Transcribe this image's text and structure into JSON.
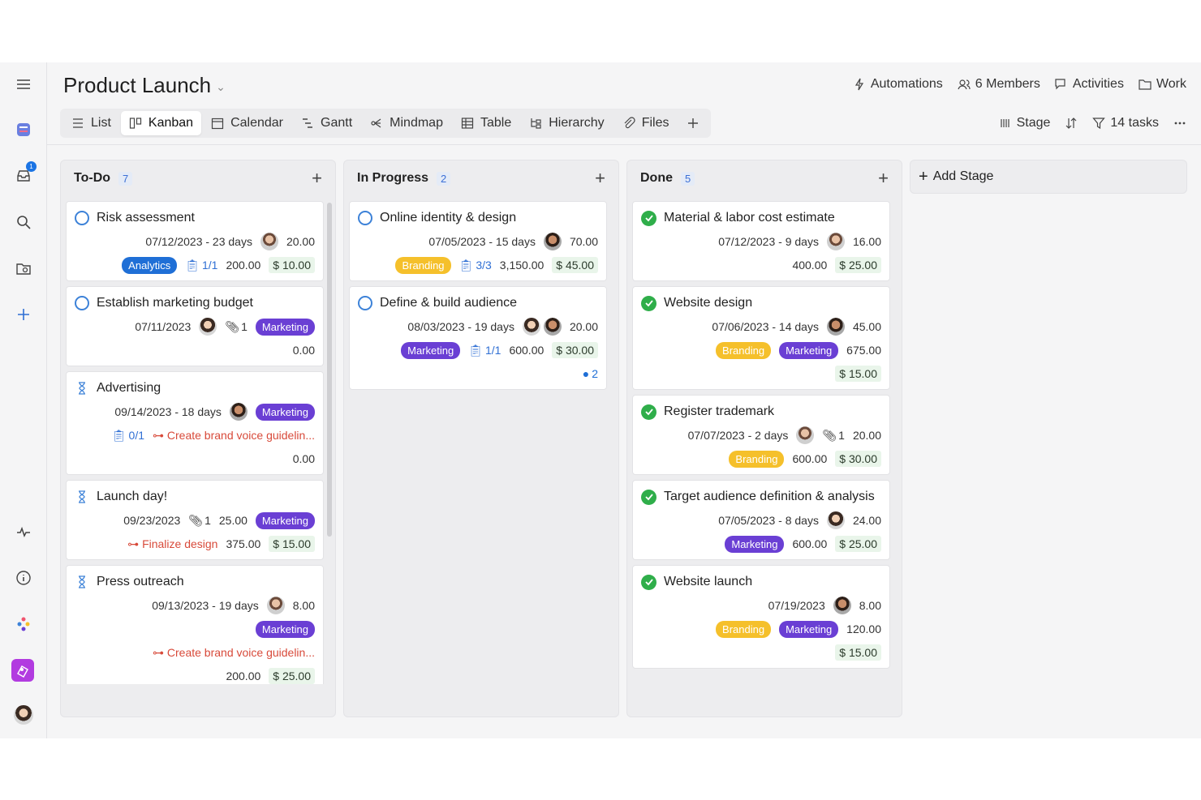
{
  "project": {
    "title": "Product Launch"
  },
  "top_actions": [
    "Automations",
    "6 Members",
    "Activities",
    "Work"
  ],
  "views": [
    "List",
    "Kanban",
    "Calendar",
    "Gantt",
    "Mindmap",
    "Table",
    "Hierarchy",
    "Files"
  ],
  "tools": {
    "group": "Stage",
    "filter": "14 tasks"
  },
  "sidebar": {
    "inbox_badge": "1"
  },
  "add_stage": "Add Stage",
  "columns": [
    {
      "name": "To-Do",
      "count": "7",
      "cards": [
        {
          "title": "Risk assessment",
          "date": "07/12/2023 - 23 days",
          "hours": "20.00",
          "tag": "Analytics",
          "sub": "1/1",
          "amount": "200.00",
          "money": "$ 10.00"
        },
        {
          "title": "Establish marketing budget",
          "date": "07/11/2023",
          "clip": "1",
          "tag": "Marketing",
          "amount": "0.00"
        },
        {
          "title": "Advertising",
          "date": "09/14/2023 - 18 days",
          "tag": "Marketing",
          "sub": "0/1",
          "link": "Create brand voice guidelin...",
          "amount": "0.00"
        },
        {
          "title": "Launch day!",
          "date": "09/23/2023",
          "clip": "1",
          "hours": "25.00",
          "tag": "Marketing",
          "link": "Finalize design",
          "amount": "375.00",
          "money": "$ 15.00"
        },
        {
          "title": "Press outreach",
          "date": "09/13/2023 - 19 days",
          "hours": "8.00",
          "tag": "Marketing",
          "link": "Create brand voice guidelin...",
          "amount": "200.00",
          "money": "$ 25.00"
        }
      ]
    },
    {
      "name": "In Progress",
      "count": "2",
      "cards": [
        {
          "title": "Online identity & design",
          "date": "07/05/2023 - 15 days",
          "hours": "70.00",
          "tag": "Branding",
          "sub": "3/3",
          "amount": "3,150.00",
          "money": "$ 45.00"
        },
        {
          "title": "Define & build audience",
          "date": "08/03/2023 - 19 days",
          "hours": "20.00",
          "tag": "Marketing",
          "sub": "1/1",
          "amount": "600.00",
          "money": "$ 30.00",
          "comments": "2"
        }
      ]
    },
    {
      "name": "Done",
      "count": "5",
      "cards": [
        {
          "title": "Material & labor cost estimate",
          "date": "07/12/2023 - 9 days",
          "hours": "16.00",
          "amount": "400.00",
          "money": "$ 25.00"
        },
        {
          "title": "Website design",
          "date": "07/06/2023 - 14 days",
          "hours": "45.00",
          "tag": "Branding",
          "tag2": "Marketing",
          "amount": "675.00",
          "money": "$ 15.00"
        },
        {
          "title": "Register trademark",
          "date": "07/07/2023 - 2 days",
          "clip": "1",
          "hours": "20.00",
          "tag": "Branding",
          "amount": "600.00",
          "money": "$ 30.00"
        },
        {
          "title": "Target audience definition & analysis",
          "date": "07/05/2023 - 8 days",
          "hours": "24.00",
          "tag": "Marketing",
          "amount": "600.00",
          "money": "$ 25.00"
        },
        {
          "title": "Website launch",
          "date": "07/19/2023",
          "hours": "8.00",
          "tag": "Branding",
          "tag2": "Marketing",
          "amount": "120.00",
          "money": "$ 15.00"
        }
      ]
    }
  ],
  "colors": {
    "analytics": "#1f6fd6",
    "marketing": "#6a3fd4",
    "branding": "#f5c02b",
    "done": "#2fae4a",
    "open": "#3d82d8"
  }
}
